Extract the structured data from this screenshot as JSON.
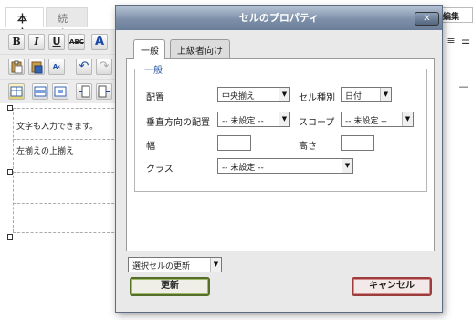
{
  "editor": {
    "tabs": [
      "本文",
      "続き"
    ],
    "right_tab_label": "ん編集",
    "cell_texts": [
      "文字も入力できます。",
      "左揃えの上揃え"
    ],
    "toolbar_icons": [
      "bold-icon",
      "italic-icon",
      "underline-icon",
      "strikethrough-icon",
      "font-color-icon",
      "paste-icon",
      "paste-word-icon",
      "spellcheck-icon",
      "undo-icon",
      "redo-icon",
      "table-icon",
      "row-icon",
      "cell-icon",
      "insert-column-before-icon",
      "insert-column-after-icon"
    ],
    "toolbar_glyphs": {
      "bold": "B",
      "italic": "I",
      "underline": "U",
      "strike": "ABC",
      "font_color": "A",
      "undo": "↶",
      "redo": "↷"
    }
  },
  "dialog": {
    "title": "セルのプロパティ",
    "close_label": "✕",
    "tabs": {
      "general": "一般",
      "advanced": "上級者向け"
    },
    "section_title": "一般",
    "fields": {
      "alignment": {
        "label": "配置",
        "value": "中央揃え"
      },
      "cell_type": {
        "label": "セル種別",
        "value": "日付"
      },
      "vertical_alignment": {
        "label": "垂直方向の配置",
        "value": "-- 未設定 --"
      },
      "scope": {
        "label": "スコープ",
        "value": "-- 未設定 --"
      },
      "width": {
        "label": "幅",
        "value": ""
      },
      "height": {
        "label": "高さ",
        "value": ""
      },
      "class": {
        "label": "クラス",
        "value": "-- 未設定 --"
      }
    },
    "update_scope": {
      "value": "選択セルの更新"
    },
    "buttons": {
      "update": "更新",
      "cancel": "キャンセル"
    }
  },
  "colors": {
    "title_bar": "#7d8fa8",
    "section_accent": "#2d5ea5",
    "update_border": "#556f2b",
    "cancel_border": "#9c3c3c"
  }
}
